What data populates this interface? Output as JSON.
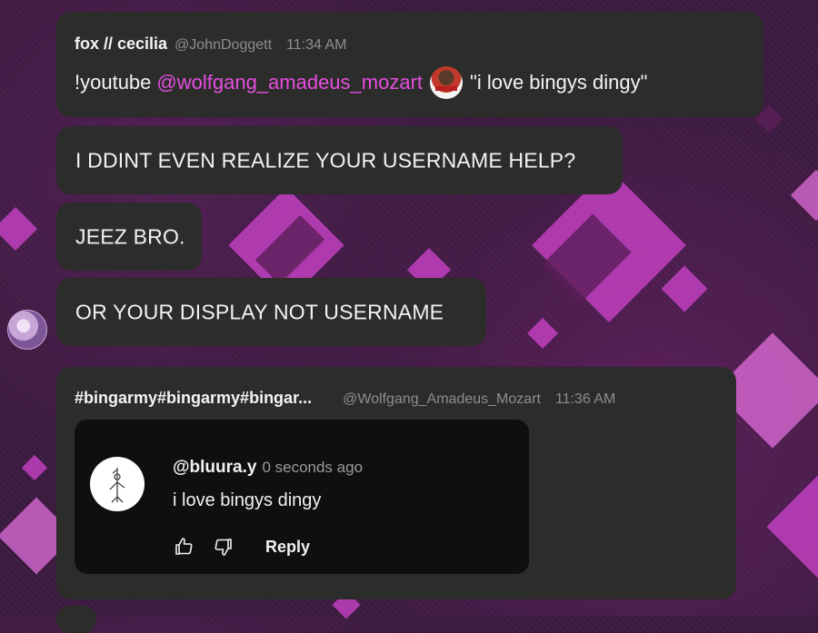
{
  "colors": {
    "bubble": "#2c2d2b",
    "mention": "#e54de1",
    "muted": "#8d8d8d",
    "card": "#0f0f0f",
    "background": "#3a1a3e"
  },
  "messages": [
    {
      "author": "fox // cecilia",
      "handle": "@JohnDoggett",
      "time": "11:34 AM",
      "content": {
        "command": "!youtube",
        "mention": "@wolfgang_amadeus_mozart",
        "avatar_icon": "user-avatar-icon",
        "quote": "\"i love bingys dingy\""
      }
    },
    {
      "text": "I DDINT EVEN REALIZE YOUR USERNAME HELP?"
    },
    {
      "text": "JEEZ BRO."
    },
    {
      "text": "OR YOUR DISPLAY NOT USERNAME"
    },
    {
      "author": "#bingarmy#bingarmy#bingar...",
      "handle": "@Wolfgang_Amadeus_Mozart",
      "time": "11:36 AM",
      "embed": {
        "user": "@bluura.y",
        "ago": "0 seconds ago",
        "comment": "i love bingys dingy",
        "like_icon": "thumbs-up-icon",
        "dislike_icon": "thumbs-down-icon",
        "reply": "Reply"
      }
    }
  ]
}
